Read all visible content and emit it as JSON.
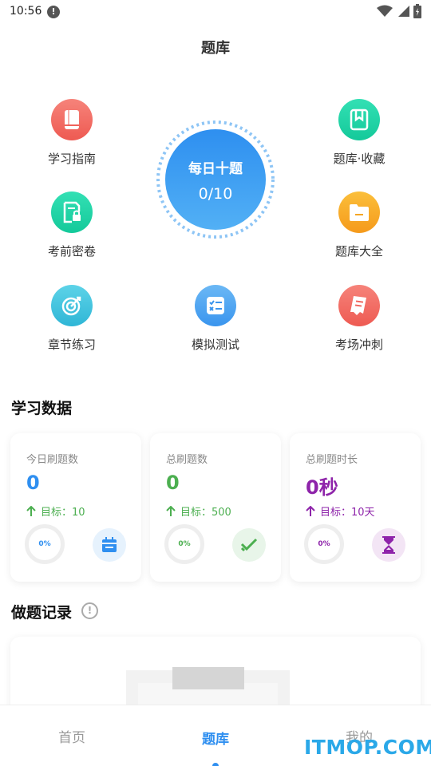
{
  "status_bar": {
    "time": "10:56",
    "alert_glyph": "!"
  },
  "header": {
    "title": "题库"
  },
  "menu": {
    "study_guide": {
      "label": "学习指南",
      "icon": "book-icon",
      "color": "#f0625a"
    },
    "bank_favorites": {
      "label": "题库·收藏",
      "icon": "bookmark-icon",
      "color": "#1fd3a5"
    },
    "exam_secret_paper": {
      "label": "考前密卷",
      "icon": "locked-document-icon",
      "color": "#1fd3a5"
    },
    "bank_collection": {
      "label": "题库大全",
      "icon": "folder-icon",
      "color": "#f5a623"
    },
    "chapter_practice": {
      "label": "章节练习",
      "icon": "target-icon",
      "color": "#3ec3e0"
    },
    "mock_test": {
      "label": "模拟测试",
      "icon": "checklist-icon",
      "color": "#4aa3f0"
    },
    "exam_sprint": {
      "label": "考场冲刺",
      "icon": "paper-icon",
      "color": "#f0625a"
    }
  },
  "daily": {
    "title": "每日十题",
    "progress_text": "0/10",
    "done": 0,
    "total": 10
  },
  "study_data": {
    "section_title": "学习数据",
    "cards": [
      {
        "label": "今日刷题数",
        "value": "0",
        "goal": "目标：10",
        "percent": "0%",
        "progress": 0,
        "color": "#2f8ff0",
        "badge_bg": "#e6f2fd",
        "icon": "calendar-icon"
      },
      {
        "label": "总刷题数",
        "value": "0",
        "goal": "目标：500",
        "percent": "0%",
        "progress": 0,
        "color": "#4caf50",
        "badge_bg": "#e8f5e9",
        "icon": "checkmark-icon"
      },
      {
        "label": "总刷题时长",
        "value": "0秒",
        "goal": "目标：10天",
        "percent": "0%",
        "progress": 0,
        "color": "#8e24aa",
        "badge_bg": "#f3e5f5",
        "icon": "hourglass-icon"
      }
    ]
  },
  "records": {
    "section_title": "做题记录",
    "info_glyph": "!"
  },
  "nav": {
    "home": "首页",
    "bank": "题库",
    "mine": "我的",
    "active": "bank"
  },
  "watermark": "ITMOP.COM"
}
